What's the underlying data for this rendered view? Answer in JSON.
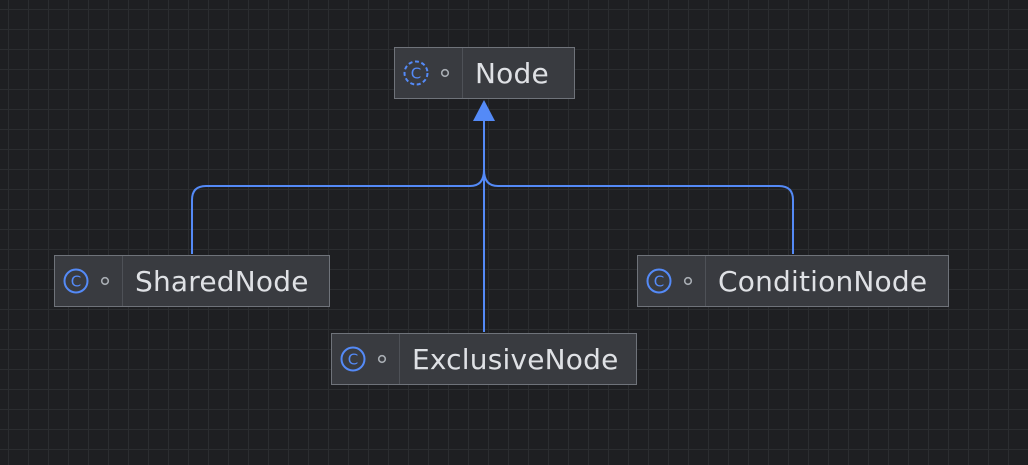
{
  "diagram": {
    "parent": {
      "name": "Node",
      "icon": "class-abstract-icon",
      "visibility_icon": "package-private-icon"
    },
    "children": [
      {
        "name": "SharedNode",
        "icon": "class-icon",
        "visibility_icon": "package-private-icon"
      },
      {
        "name": "ExclusiveNode",
        "icon": "class-icon",
        "visibility_icon": "package-private-icon"
      },
      {
        "name": "ConditionNode",
        "icon": "class-icon",
        "visibility_icon": "package-private-icon"
      }
    ],
    "relations": [
      {
        "from": "SharedNode",
        "to": "Node",
        "type": "extends"
      },
      {
        "from": "ExclusiveNode",
        "to": "Node",
        "type": "extends"
      },
      {
        "from": "ConditionNode",
        "to": "Node",
        "type": "extends"
      }
    ],
    "colors": {
      "background": "#1e1f22",
      "grid": "#2b2d30",
      "node_fill": "#393b40",
      "node_border": "#6f737a",
      "edge": "#548af7",
      "icon": "#548af7",
      "text": "#dfe1e5"
    }
  }
}
